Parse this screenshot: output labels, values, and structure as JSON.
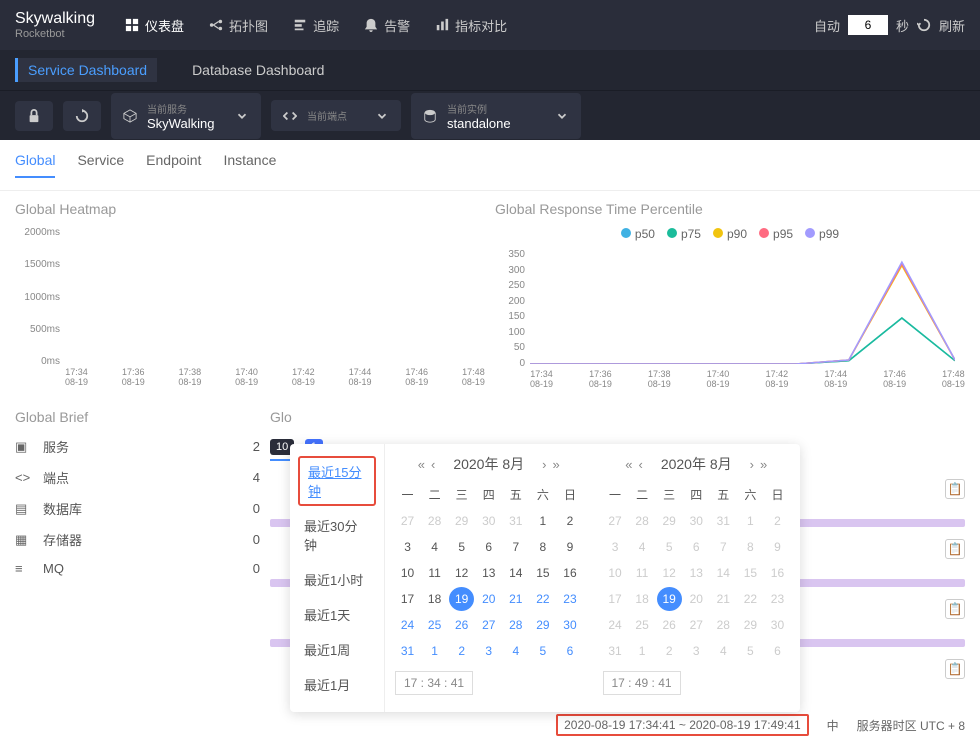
{
  "brand": {
    "name": "Skywalking",
    "sub": "Rocketbot"
  },
  "nav": {
    "dashboard": "仪表盘",
    "topology": "拓扑图",
    "trace": "追踪",
    "alarm": "告警",
    "compare": "指标对比"
  },
  "topRight": {
    "auto": "自动",
    "autoValue": "6",
    "seconds": "秒",
    "refresh": "刷新"
  },
  "sub": {
    "service": "Service Dashboard",
    "database": "Database Dashboard"
  },
  "selectors": {
    "currentService": {
      "label": "当前服务",
      "value": "SkyWalking"
    },
    "currentEndpoint": {
      "label": "当前端点",
      "value": ""
    },
    "currentInstance": {
      "label": "当前实例",
      "value": "standalone"
    }
  },
  "tabs": {
    "global": "Global",
    "service": "Service",
    "endpoint": "Endpoint",
    "instance": "Instance"
  },
  "heatmap": {
    "title": "Global Heatmap"
  },
  "percentile": {
    "title": "Global Response Time Percentile",
    "legend": {
      "p50": "p50",
      "p75": "p75",
      "p90": "p90",
      "p95": "p95",
      "p99": "p99"
    }
  },
  "chart_data": [
    {
      "type": "line",
      "title": "Global Heatmap",
      "xlabel": "",
      "ylabel": "",
      "categories": [
        "17:34 08-19",
        "17:36 08-19",
        "17:38 08-19",
        "17:40 08-19",
        "17:42 08-19",
        "17:44 08-19",
        "17:46 08-19",
        "17:48 08-19"
      ],
      "y_ticks": [
        "2000ms",
        "1500ms",
        "1000ms",
        "500ms",
        "0ms"
      ],
      "series": [],
      "ylim": [
        0,
        2000
      ]
    },
    {
      "type": "line",
      "title": "Global Response Time Percentile",
      "xlabel": "",
      "ylabel": "",
      "categories": [
        "17:34 08-19",
        "17:36 08-19",
        "17:38 08-19",
        "17:40 08-19",
        "17:42 08-19",
        "17:44 08-19",
        "17:46 08-19",
        "17:48 08-19"
      ],
      "y_ticks": [
        "350",
        "300",
        "250",
        "200",
        "150",
        "100",
        "50",
        "0"
      ],
      "ylim": [
        0,
        350
      ],
      "series": [
        {
          "name": "p50",
          "color": "#3fb1e3",
          "values": [
            0,
            0,
            0,
            0,
            0,
            0,
            10,
            140,
            10
          ]
        },
        {
          "name": "p75",
          "color": "#1bbc9b",
          "values": [
            0,
            0,
            0,
            0,
            0,
            0,
            10,
            140,
            10
          ]
        },
        {
          "name": "p90",
          "color": "#f1c40f",
          "values": [
            0,
            0,
            0,
            0,
            0,
            0,
            12,
            300,
            12
          ]
        },
        {
          "name": "p95",
          "color": "#ff6b81",
          "values": [
            0,
            0,
            0,
            0,
            0,
            0,
            12,
            305,
            12
          ]
        },
        {
          "name": "p99",
          "color": "#a29bfe",
          "values": [
            0,
            0,
            0,
            0,
            0,
            0,
            12,
            310,
            12
          ]
        }
      ]
    }
  ],
  "brief": {
    "title": "Global Brief",
    "items": [
      {
        "label": "服务",
        "value": "2"
      },
      {
        "label": "端点",
        "value": "4"
      },
      {
        "label": "数据库",
        "value": "0"
      },
      {
        "label": "存储器",
        "value": "0"
      },
      {
        "label": "MQ",
        "value": "0"
      }
    ]
  },
  "slow": {
    "title": "Glo",
    "badge1": "10",
    "badge2": "1"
  },
  "datepicker": {
    "shortcuts": [
      "最近15分钟",
      "最近30分钟",
      "最近1小时",
      "最近1天",
      "最近1周",
      "最近1月"
    ],
    "monthLabel": "2020年 8月",
    "dows": [
      "一",
      "二",
      "三",
      "四",
      "五",
      "六",
      "日"
    ],
    "leftTime": "17 : 34 : 41",
    "rightTime": "17 : 49 : 41",
    "leftDays": {
      "pre": [
        "27",
        "28",
        "29",
        "30",
        "31"
      ],
      "days": [
        "1",
        "2",
        "3",
        "4",
        "5",
        "6",
        "7",
        "8",
        "9",
        "10",
        "11",
        "12",
        "13",
        "14",
        "15",
        "16",
        "17",
        "18",
        "19",
        "20",
        "21",
        "22",
        "23",
        "24",
        "25",
        "26",
        "27",
        "28",
        "29",
        "30",
        "31"
      ],
      "post": [
        "1",
        "2",
        "3",
        "4",
        "5",
        "6"
      ],
      "selected": "19",
      "rangeFrom": 20
    },
    "rightDays": {
      "pre": [
        "27",
        "28",
        "29",
        "30",
        "31"
      ],
      "days": [
        "1",
        "2",
        "3",
        "4",
        "5",
        "6",
        "7",
        "8",
        "9",
        "10",
        "11",
        "12",
        "13",
        "14",
        "15",
        "16",
        "17",
        "18",
        "19",
        "20",
        "21",
        "22",
        "23",
        "24",
        "25",
        "26",
        "27",
        "28",
        "29",
        "30",
        "31"
      ],
      "post": [
        "1",
        "2",
        "3",
        "4",
        "5",
        "6"
      ],
      "selected": "19"
    }
  },
  "footer": {
    "range": "2020-08-19 17:34:41 ~ 2020-08-19 17:49:41",
    "lang": "中",
    "tz": "服务器时区 UTC + 8"
  }
}
